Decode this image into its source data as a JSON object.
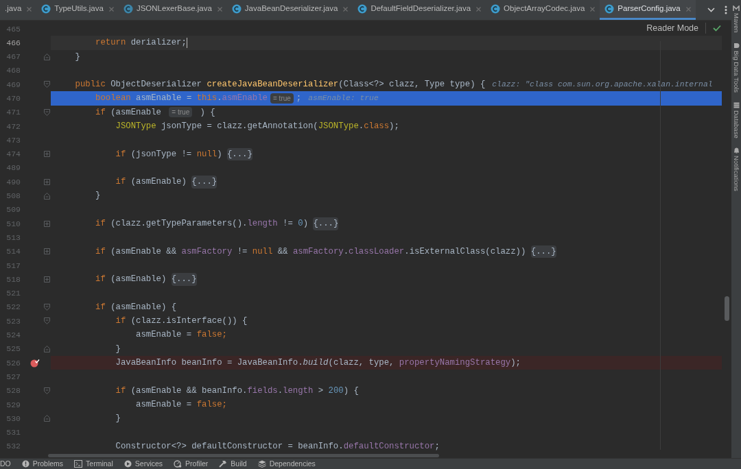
{
  "tabs": [
    {
      "label": ".java",
      "selected": false
    },
    {
      "label": "TypeUtils.java",
      "selected": false
    },
    {
      "label": "JSONLexerBase.java",
      "selected": false
    },
    {
      "label": "JavaBeanDeserializer.java",
      "selected": false
    },
    {
      "label": "DefaultFieldDeserializer.java",
      "selected": false
    },
    {
      "label": "ObjectArrayCodec.java",
      "selected": false
    },
    {
      "label": "ParserConfig.java",
      "selected": true
    }
  ],
  "reader_mode": "Reader Mode",
  "lines": [
    {
      "number": "465",
      "kind": "plain",
      "caret": false,
      "execution_point": false,
      "breakpoint": false
    },
    {
      "number": "466",
      "kind": "plain",
      "caret": true,
      "execution_point": false,
      "breakpoint": false,
      "tokens": [
        {
          "kind": "kw",
          "text": "        return"
        },
        {
          "kind": "plain",
          "text": " derializer;"
        }
      ]
    },
    {
      "number": "467",
      "kind": "fold-end",
      "caret": false,
      "execution_point": false,
      "breakpoint": false,
      "tokens": [
        {
          "kind": "plain",
          "text": "    }"
        }
      ]
    },
    {
      "number": "468",
      "kind": "plain",
      "caret": false,
      "execution_point": false,
      "breakpoint": false
    },
    {
      "number": "469",
      "kind": "fold-start",
      "caret": false,
      "execution_point": false,
      "breakpoint": false,
      "tokens": [
        {
          "kind": "kw",
          "text": "    public"
        },
        {
          "kind": "plain",
          "text": " ObjectDeserializer "
        },
        {
          "kind": "method",
          "text": "createJavaBeanDeserializer"
        },
        {
          "kind": "plain",
          "text": "(Class<?> clazz, Type type) {"
        },
        {
          "kind": "debug",
          "text": "clazz: \"class com.sun.org.apache.xalan.internal"
        }
      ]
    },
    {
      "number": "470",
      "kind": "plain",
      "caret": false,
      "execution_point": true,
      "breakpoint": false,
      "tokens": [
        {
          "kind": "kw",
          "text": "        boolean"
        },
        {
          "kind": "plain",
          "text": " asmEnable = "
        },
        {
          "kind": "kw",
          "text": "this"
        },
        {
          "kind": "plain",
          "text": "."
        },
        {
          "kind": "field",
          "text": "asmEnable"
        },
        {
          "kind": "hint",
          "text": "= true"
        },
        {
          "kind": "plain",
          "text": ";"
        },
        {
          "kind": "debug",
          "text": "asmEnable: true"
        }
      ]
    },
    {
      "number": "471",
      "kind": "fold-start",
      "caret": false,
      "execution_point": false,
      "breakpoint": false,
      "tokens": [
        {
          "kind": "kw",
          "text": "        if"
        },
        {
          "kind": "plain",
          "text": " (asmEnable "
        },
        {
          "kind": "hint",
          "text": "= true"
        },
        {
          "kind": "plain",
          "text": " ) {"
        }
      ]
    },
    {
      "number": "472",
      "kind": "plain",
      "caret": false,
      "execution_point": false,
      "breakpoint": false,
      "tokens": [
        {
          "kind": "type",
          "text": "            JSONType"
        },
        {
          "kind": "plain",
          "text": " jsonType = clazz.getAnnotation("
        },
        {
          "kind": "type",
          "text": "JSONType"
        },
        {
          "kind": "plain",
          "text": "."
        },
        {
          "kind": "kw",
          "text": "class"
        },
        {
          "kind": "plain",
          "text": ");"
        }
      ]
    },
    {
      "number": "473",
      "kind": "plain",
      "caret": false,
      "execution_point": false,
      "breakpoint": false
    },
    {
      "number": "474",
      "kind": "folded",
      "caret": false,
      "execution_point": false,
      "breakpoint": false,
      "tokens": [
        {
          "kind": "kw",
          "text": "            if"
        },
        {
          "kind": "plain",
          "text": " (jsonType != "
        },
        {
          "kind": "kw",
          "text": "null"
        },
        {
          "kind": "plain",
          "text": ") "
        },
        {
          "kind": "fold",
          "text": "{...}"
        }
      ]
    },
    {
      "number": "489",
      "kind": "plain",
      "caret": false,
      "execution_point": false,
      "breakpoint": false
    },
    {
      "number": "490",
      "kind": "folded",
      "caret": false,
      "execution_point": false,
      "breakpoint": false,
      "tokens": [
        {
          "kind": "kw",
          "text": "            if"
        },
        {
          "kind": "plain",
          "text": " (asmEnable) "
        },
        {
          "kind": "fold",
          "text": "{...}"
        }
      ]
    },
    {
      "number": "508",
      "kind": "fold-end",
      "caret": false,
      "execution_point": false,
      "breakpoint": false,
      "tokens": [
        {
          "kind": "plain",
          "text": "        }"
        }
      ]
    },
    {
      "number": "509",
      "kind": "plain",
      "caret": false,
      "execution_point": false,
      "breakpoint": false
    },
    {
      "number": "510",
      "kind": "folded",
      "caret": false,
      "execution_point": false,
      "breakpoint": false,
      "tokens": [
        {
          "kind": "kw",
          "text": "        if"
        },
        {
          "kind": "plain",
          "text": " (clazz.getTypeParameters()."
        },
        {
          "kind": "field",
          "text": "length"
        },
        {
          "kind": "plain",
          "text": " != "
        },
        {
          "kind": "num",
          "text": "0"
        },
        {
          "kind": "plain",
          "text": ") "
        },
        {
          "kind": "fold",
          "text": "{...}"
        }
      ]
    },
    {
      "number": "513",
      "kind": "plain",
      "caret": false,
      "execution_point": false,
      "breakpoint": false
    },
    {
      "number": "514",
      "kind": "folded",
      "caret": false,
      "execution_point": false,
      "breakpoint": false,
      "tokens": [
        {
          "kind": "kw",
          "text": "        if"
        },
        {
          "kind": "plain",
          "text": " (asmEnable && "
        },
        {
          "kind": "field",
          "text": "asmFactory"
        },
        {
          "kind": "plain",
          "text": " != "
        },
        {
          "kind": "kw",
          "text": "null"
        },
        {
          "kind": "plain",
          "text": " && "
        },
        {
          "kind": "field",
          "text": "asmFactory"
        },
        {
          "kind": "plain",
          "text": "."
        },
        {
          "kind": "field",
          "text": "classLoader"
        },
        {
          "kind": "plain",
          "text": ".isExternalClass(clazz)) "
        },
        {
          "kind": "fold",
          "text": "{...}"
        }
      ]
    },
    {
      "number": "517",
      "kind": "plain",
      "caret": false,
      "execution_point": false,
      "breakpoint": false
    },
    {
      "number": "518",
      "kind": "folded",
      "caret": false,
      "execution_point": false,
      "breakpoint": false,
      "tokens": [
        {
          "kind": "kw",
          "text": "        if"
        },
        {
          "kind": "plain",
          "text": " (asmEnable) "
        },
        {
          "kind": "fold",
          "text": "{...}"
        }
      ]
    },
    {
      "number": "521",
      "kind": "plain",
      "caret": false,
      "execution_point": false,
      "breakpoint": false
    },
    {
      "number": "522",
      "kind": "fold-start",
      "caret": false,
      "execution_point": false,
      "breakpoint": false,
      "tokens": [
        {
          "kind": "kw",
          "text": "        if"
        },
        {
          "kind": "plain",
          "text": " (asmEnable) {"
        }
      ]
    },
    {
      "number": "523",
      "kind": "fold-start",
      "caret": false,
      "execution_point": false,
      "breakpoint": false,
      "tokens": [
        {
          "kind": "kw",
          "text": "            if"
        },
        {
          "kind": "plain",
          "text": " (clazz.isInterface()) {"
        }
      ]
    },
    {
      "number": "524",
      "kind": "plain",
      "caret": false,
      "execution_point": false,
      "breakpoint": false,
      "tokens": [
        {
          "kind": "plain",
          "text": "                asmEnable = "
        },
        {
          "kind": "kw",
          "text": "false;"
        }
      ]
    },
    {
      "number": "525",
      "kind": "fold-end",
      "caret": false,
      "execution_point": false,
      "breakpoint": false,
      "tokens": [
        {
          "kind": "plain",
          "text": "            }"
        }
      ]
    },
    {
      "number": "526",
      "kind": "plain",
      "caret": false,
      "execution_point": false,
      "breakpoint": true,
      "tokens": [
        {
          "kind": "plain",
          "text": "            JavaBeanInfo beanInfo = JavaBeanInfo."
        },
        {
          "kind": "italic",
          "text": "build"
        },
        {
          "kind": "plain",
          "text": "(clazz, type, "
        },
        {
          "kind": "field",
          "text": "propertyNamingStrategy"
        },
        {
          "kind": "plain",
          "text": ");"
        }
      ]
    },
    {
      "number": "527",
      "kind": "plain",
      "caret": false,
      "execution_point": false,
      "breakpoint": false
    },
    {
      "number": "528",
      "kind": "fold-start",
      "caret": false,
      "execution_point": false,
      "breakpoint": false,
      "tokens": [
        {
          "kind": "kw",
          "text": "            if"
        },
        {
          "kind": "plain",
          "text": " (asmEnable && beanInfo."
        },
        {
          "kind": "field",
          "text": "fields"
        },
        {
          "kind": "plain",
          "text": "."
        },
        {
          "kind": "field",
          "text": "length"
        },
        {
          "kind": "plain",
          "text": " > "
        },
        {
          "kind": "num",
          "text": "200"
        },
        {
          "kind": "plain",
          "text": ") {"
        }
      ]
    },
    {
      "number": "529",
      "kind": "plain",
      "caret": false,
      "execution_point": false,
      "breakpoint": false,
      "tokens": [
        {
          "kind": "plain",
          "text": "                asmEnable = "
        },
        {
          "kind": "kw",
          "text": "false;"
        }
      ]
    },
    {
      "number": "530",
      "kind": "fold-end",
      "caret": false,
      "execution_point": false,
      "breakpoint": false,
      "tokens": [
        {
          "kind": "plain",
          "text": "            }"
        }
      ]
    },
    {
      "number": "531",
      "kind": "plain",
      "caret": false,
      "execution_point": false,
      "breakpoint": false
    },
    {
      "number": "532",
      "kind": "plain",
      "caret": false,
      "execution_point": false,
      "breakpoint": false,
      "tokens": [
        {
          "kind": "plain",
          "text": "            Constructor<?> defaultConstructor = beanInfo."
        },
        {
          "kind": "field",
          "text": "defaultConstructor"
        },
        {
          "kind": "plain",
          "text": ";"
        }
      ]
    }
  ],
  "side_tools": [
    "Maven",
    "Big Data Tools",
    "Database",
    "Notifications"
  ],
  "status_bar": [
    {
      "kind": "todo",
      "label": "DO"
    },
    {
      "kind": "problems",
      "label": "Problems"
    },
    {
      "kind": "terminal",
      "label": "Terminal"
    },
    {
      "kind": "services",
      "label": "Services"
    },
    {
      "kind": "profiler",
      "label": "Profiler"
    },
    {
      "kind": "build",
      "label": "Build"
    },
    {
      "kind": "dependencies",
      "label": "Dependencies"
    }
  ]
}
